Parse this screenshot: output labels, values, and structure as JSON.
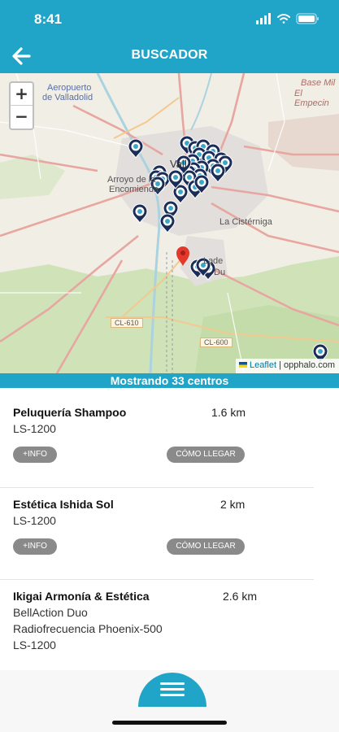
{
  "status_bar": {
    "time": "8:41"
  },
  "header": {
    "title": "BUSCADOR",
    "back_icon": "arrow-left-icon"
  },
  "map": {
    "zoom_in_label": "+",
    "zoom_out_label": "−",
    "attribution_leaflet": "Leaflet",
    "attribution_separator": " | ",
    "attribution_source": "opphalo.com",
    "labels": {
      "valladolid": "Vall",
      "arroyo": "Arroyo de la",
      "encomienda": "Encomienda",
      "cisterniga": "La Cistérniga",
      "laguna": "La",
      "laguna2": "de",
      "laguna3": "Du",
      "base": "Base Mil",
      "empecinado": "El Empecin",
      "aero": "Aeropuerto",
      "aero2": "de Valladolid",
      "cl610": "CL-610",
      "cl600": "CL-600"
    },
    "marker_count": 33,
    "colors": {
      "marker": "#1b2d57",
      "user_pin": "#e3392c",
      "roads": "#e8a6a0",
      "green": "#c9dfb3"
    }
  },
  "results_summary": "Mostrando 33 centros",
  "results": [
    {
      "name": "Peluquería Shampoo",
      "distance": "1.6 km",
      "services": [
        "LS-1200"
      ],
      "info_label": "+INFO",
      "directions_label": "CÓMO LLEGAR"
    },
    {
      "name": "Estética Ishida Sol",
      "distance": "2 km",
      "services": [
        "LS-1200"
      ],
      "info_label": "+INFO",
      "directions_label": "CÓMO LLEGAR"
    },
    {
      "name": "Ikigai Armonía & Estética",
      "distance": "2.6 km",
      "services": [
        "BellAction Duo",
        "Radiofrecuencia Phoenix-500",
        "LS-1200"
      ]
    }
  ],
  "bottom_nav": {
    "menu_icon": "hamburger-menu-icon"
  },
  "colors": {
    "accent": "#20a5c8",
    "pill": "#8a8a8a"
  }
}
